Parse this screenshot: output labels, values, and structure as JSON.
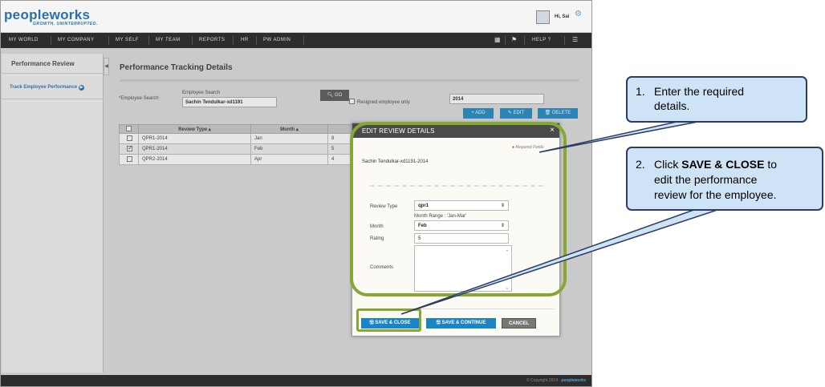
{
  "header": {
    "logo_main": "peopleworks",
    "tagline": "GROWTH. UNINTERRUPTED.",
    "greeting": "Hi, Sai"
  },
  "nav": {
    "items": [
      "MY WORLD",
      "MY COMPANY",
      "MY SELF",
      "MY TEAM",
      "REPORTS",
      "HR",
      "PW ADMIN"
    ],
    "help": "HELP"
  },
  "sidebar": {
    "title": "Performance Review",
    "link": "Track Employee Performance"
  },
  "main": {
    "title": "Performance Tracking Details",
    "employee_search_label": "*Employee Search",
    "employee_search_field_label": "Employee Search",
    "employee_search_value": "Sachin Tendulkar-xd1191",
    "go_label": "GO",
    "resigned_label": "Resigned employee only",
    "year_value": "2014",
    "add_label": "ADD",
    "edit_label": "EDIT",
    "delete_label": "DELETE",
    "table": {
      "headers": [
        "Review Type",
        "Month"
      ],
      "rows": [
        {
          "review_type": "QPR1-2014",
          "month": "Jan",
          "rating": "8",
          "checked": false
        },
        {
          "review_type": "QPR1-2014",
          "month": "Feb",
          "rating": "5",
          "checked": true
        },
        {
          "review_type": "QPR2-2014",
          "month": "Apr",
          "rating": "4",
          "checked": false
        }
      ]
    }
  },
  "modal": {
    "title": "EDIT REVIEW DETAILS",
    "required_note": "Required Fields",
    "employee": "Sachin Tendulkar-xd1191-2014",
    "review_type_label": "Review Type",
    "review_type_value": "qpr1",
    "month_range": "Month Range : 'Jan-Mar'",
    "month_label": "Month",
    "month_value": "Feb",
    "rating_label": "Rating",
    "rating_value": "5",
    "comments_label": "Comments",
    "save_close_label": "SAVE & CLOSE",
    "save_continue_label": "SAVE & CONTINUE",
    "cancel_label": "CANCEL"
  },
  "footer": {
    "copyright": "© Copyright 2014 -",
    "brand": "peopleworks"
  },
  "callouts": {
    "step1_num": "1.",
    "step1_line1": "Enter the required",
    "step1_line2": "details.",
    "step2_num": "2.",
    "step2_pre": "Click ",
    "step2_bold": "SAVE & CLOSE",
    "step2_post": " to",
    "step2_line2": "edit the performance",
    "step2_line3": "review for the employee."
  },
  "colors": {
    "accent_blue": "#1b85c4",
    "highlight_green": "#86a832",
    "callout_fill": "#cfe3f6",
    "callout_border": "#2b3d63",
    "nav_dark": "#2d2d2d"
  }
}
